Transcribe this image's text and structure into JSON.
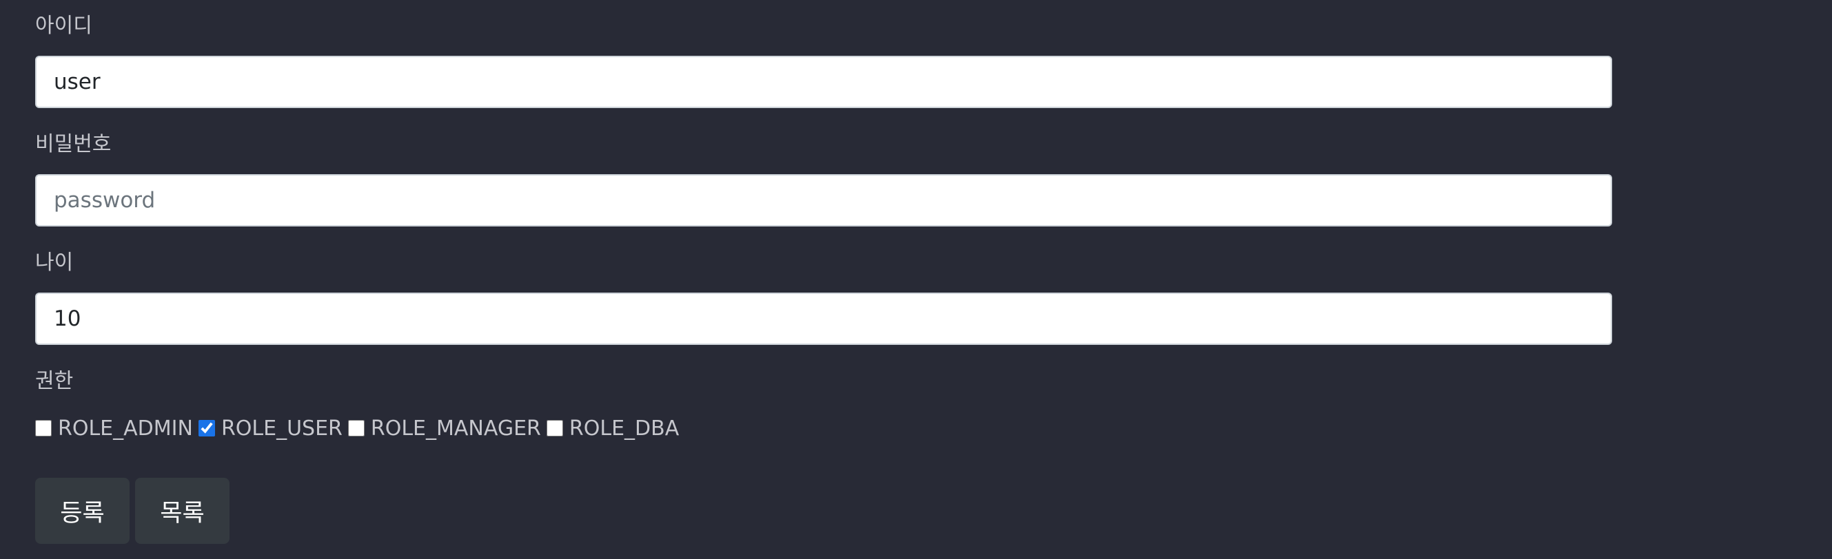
{
  "form": {
    "username": {
      "label": "아이디",
      "value": "user",
      "placeholder": ""
    },
    "password": {
      "label": "비밀번호",
      "value": "",
      "placeholder": "password"
    },
    "age": {
      "label": "나이",
      "value": "10",
      "placeholder": ""
    },
    "roles": {
      "label": "권한",
      "options": [
        {
          "label": "ROLE_ADMIN",
          "checked": false
        },
        {
          "label": "ROLE_USER",
          "checked": true
        },
        {
          "label": "ROLE_MANAGER",
          "checked": false
        },
        {
          "label": "ROLE_DBA",
          "checked": false
        }
      ]
    }
  },
  "buttons": {
    "register_label": "등록",
    "list_label": "목록"
  },
  "colors": {
    "background": "#282a36",
    "input_background": "#ffffff",
    "button_background": "#343a40",
    "checkbox_accent": "#1a73e8"
  }
}
